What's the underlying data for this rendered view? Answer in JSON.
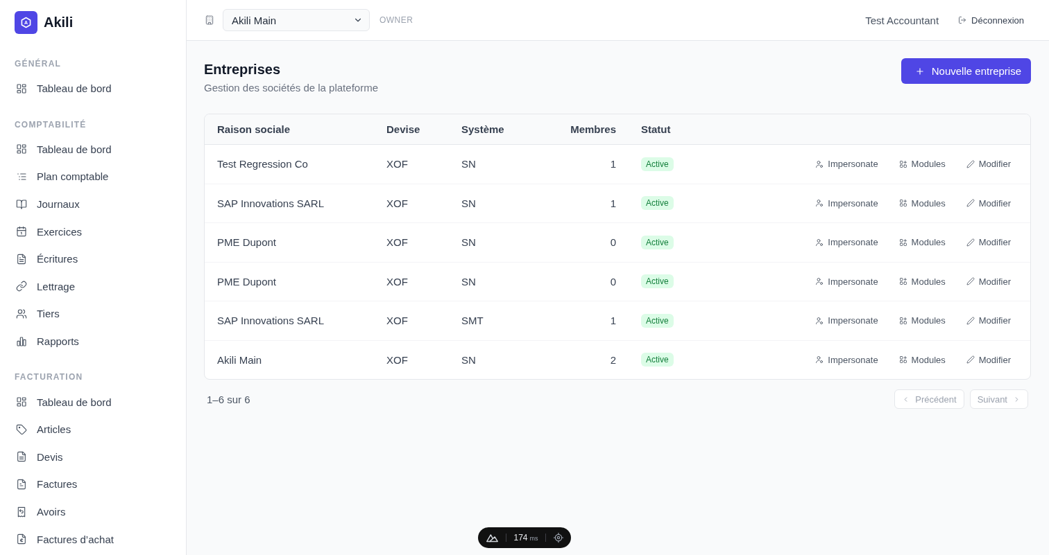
{
  "brand": {
    "logo_letter": "A",
    "name": "Akili"
  },
  "sidebar": {
    "sections": [
      {
        "title": "GÉNÉRAL",
        "items": [
          {
            "kind": "dashboard",
            "label": "Tableau de bord"
          }
        ]
      },
      {
        "title": "COMPTABILITÉ",
        "items": [
          {
            "kind": "dashboard",
            "label": "Tableau de bord"
          },
          {
            "kind": "accounts",
            "label": "Plan comptable"
          },
          {
            "kind": "journals",
            "label": "Journaux"
          },
          {
            "kind": "periods",
            "label": "Exercices"
          },
          {
            "kind": "entries",
            "label": "Écritures"
          },
          {
            "kind": "matching",
            "label": "Lettrage"
          },
          {
            "kind": "parties",
            "label": "Tiers"
          },
          {
            "kind": "reports",
            "label": "Rapports"
          }
        ]
      },
      {
        "title": "FACTURATION",
        "items": [
          {
            "kind": "dashboard",
            "label": "Tableau de bord"
          },
          {
            "kind": "articles",
            "label": "Articles"
          },
          {
            "kind": "quotes",
            "label": "Devis"
          },
          {
            "kind": "invoices",
            "label": "Factures"
          },
          {
            "kind": "credits",
            "label": "Avoirs"
          },
          {
            "kind": "purchases",
            "label": "Factures d’achat"
          }
        ]
      }
    ]
  },
  "top_bar": {
    "company_select": {
      "value": "Akili Main"
    },
    "role": "OWNER",
    "user": "Test Accountant",
    "logout": "Déconnexion"
  },
  "page": {
    "title": "Entreprises",
    "subtitle": "Gestion des sociétés de la plateforme",
    "new_button": "Nouvelle entreprise"
  },
  "table": {
    "columns": [
      "Raison sociale",
      "Devise",
      "Système",
      "Membres",
      "Statut"
    ],
    "rows": [
      {
        "name": "Test Regression Co",
        "currency": "XOF",
        "system": "SN",
        "members": "1",
        "status": "Active",
        "actions": [
          {
            "kind": "impersonate",
            "label": "Impersonate"
          },
          {
            "kind": "modules",
            "label": "Modules"
          },
          {
            "kind": "edit",
            "label": "Modifier"
          }
        ]
      },
      {
        "name": "SAP Innovations SARL",
        "currency": "XOF",
        "system": "SN",
        "members": "1",
        "status": "Active",
        "actions": [
          {
            "kind": "impersonate",
            "label": "Impersonate"
          },
          {
            "kind": "modules",
            "label": "Modules"
          },
          {
            "kind": "edit",
            "label": "Modifier"
          }
        ]
      },
      {
        "name": "PME Dupont",
        "currency": "XOF",
        "system": "SN",
        "members": "0",
        "status": "Active",
        "actions": [
          {
            "kind": "impersonate",
            "label": "Impersonate"
          },
          {
            "kind": "modules",
            "label": "Modules"
          },
          {
            "kind": "edit",
            "label": "Modifier"
          }
        ]
      },
      {
        "name": "PME Dupont",
        "currency": "XOF",
        "system": "SN",
        "members": "0",
        "status": "Active",
        "actions": [
          {
            "kind": "impersonate",
            "label": "Impersonate"
          },
          {
            "kind": "modules",
            "label": "Modules"
          },
          {
            "kind": "edit",
            "label": "Modifier"
          }
        ]
      },
      {
        "name": "SAP Innovations SARL",
        "currency": "XOF",
        "system": "SMT",
        "members": "1",
        "status": "Active",
        "actions": [
          {
            "kind": "impersonate",
            "label": "Impersonate"
          },
          {
            "kind": "modules",
            "label": "Modules"
          },
          {
            "kind": "edit",
            "label": "Modifier"
          }
        ]
      },
      {
        "name": "Akili Main",
        "currency": "XOF",
        "system": "SN",
        "members": "2",
        "status": "Active",
        "actions": [
          {
            "kind": "impersonate",
            "label": "Impersonate"
          },
          {
            "kind": "modules",
            "label": "Modules"
          },
          {
            "kind": "edit",
            "label": "Modifier"
          }
        ]
      }
    ]
  },
  "pagination": {
    "summary": "1–6 sur 6",
    "buttons": [
      {
        "kind": "previous",
        "label": "Précédent",
        "disabled": true
      },
      {
        "kind": "next",
        "label": "Suivant",
        "disabled": true
      }
    ]
  },
  "devtools": {
    "timing": "174",
    "unit": "ms"
  }
}
